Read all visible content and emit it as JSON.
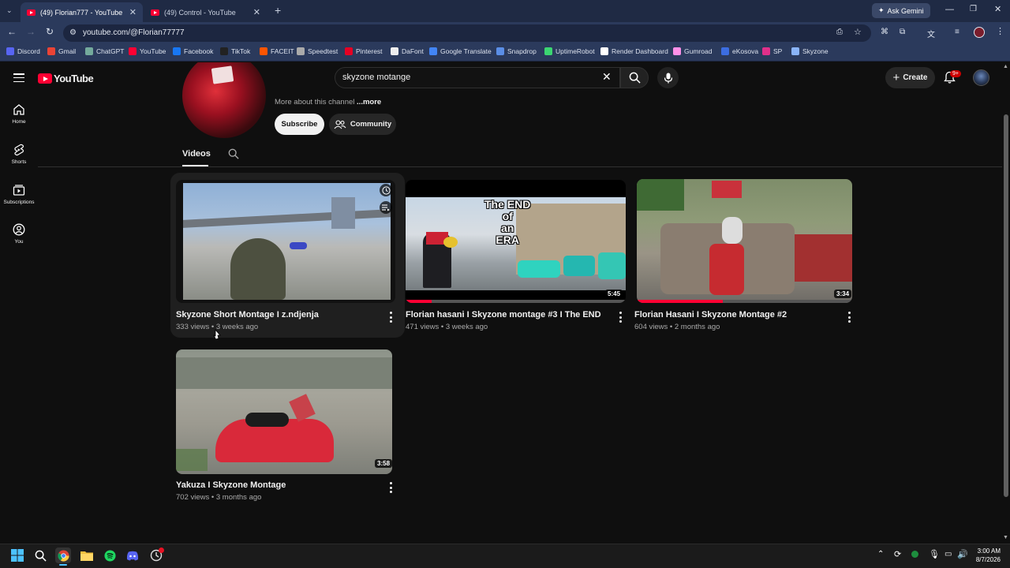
{
  "browser": {
    "tabs": [
      {
        "label": "(49) Florian777 - YouTube",
        "active": true
      },
      {
        "label": "(49) Control - YouTube",
        "active": false
      }
    ],
    "new_tab": "+",
    "ask_gemini": "Ask Gemini",
    "url": "youtube.com/@Florian77777",
    "bookmarks": [
      "Discord",
      "Gmail",
      "ChatGPT",
      "YouTube",
      "Facebook",
      "TikTok",
      "FACEIT",
      "Speedtest",
      "Pinterest",
      "DaFont",
      "Google Translate",
      "Snapdrop",
      "UptimeRobot",
      "Render Dashboard",
      "Gumroad",
      "eKosova",
      "SP",
      "Skyzone"
    ]
  },
  "youtube": {
    "logo": "YouTube",
    "search": {
      "value": "skyzone motange"
    },
    "create_label": "Create",
    "notif_badge": "9+",
    "nav": [
      {
        "label": "Home",
        "icon": "home-icon"
      },
      {
        "label": "Shorts",
        "icon": "shorts-icon"
      },
      {
        "label": "Subscriptions",
        "icon": "subscriptions-icon"
      },
      {
        "label": "You",
        "icon": "you-icon"
      }
    ],
    "channel": {
      "about": "More about this channel",
      "more": "...more",
      "subscribe": "Subscribe",
      "community": "Community"
    },
    "tabs": {
      "videos": "Videos"
    },
    "videos": [
      {
        "title": "Skyzone Short Montage I z.ndjenja",
        "views": "333 views",
        "age": "3 weeks ago",
        "duration": ""
      },
      {
        "title": "Florian hasani I Skyzone montage #3 I The END",
        "views": "471 views",
        "age": "3 weeks ago",
        "duration": "5:45",
        "overlay": [
          "The END",
          "of",
          "an",
          "ERA"
        ]
      },
      {
        "title": "Florian Hasani I Skyzone Montage #2",
        "views": "604 views",
        "age": "2 months ago",
        "duration": "3:34"
      },
      {
        "title": "Yakuza I Skyzone Montage",
        "views": "702 views",
        "age": "3 months ago",
        "duration": "3:58"
      }
    ],
    "separator": "•"
  },
  "taskbar": {
    "time": "3:00 AM",
    "date": "8/7/2026"
  },
  "colors": {
    "yt_red": "#ff0033",
    "bg": "#0f0f0f",
    "chrome": "#2b3a5c"
  }
}
